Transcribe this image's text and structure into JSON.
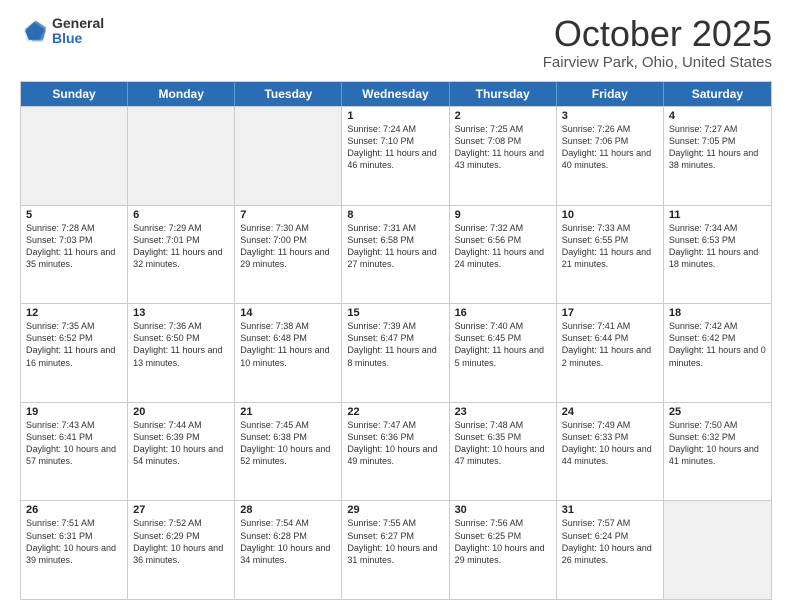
{
  "logo": {
    "general": "General",
    "blue": "Blue"
  },
  "header": {
    "month": "October 2025",
    "location": "Fairview Park, Ohio, United States"
  },
  "days": [
    "Sunday",
    "Monday",
    "Tuesday",
    "Wednesday",
    "Thursday",
    "Friday",
    "Saturday"
  ],
  "rows": [
    [
      {
        "day": "",
        "text": "",
        "shaded": true
      },
      {
        "day": "",
        "text": "",
        "shaded": true
      },
      {
        "day": "",
        "text": "",
        "shaded": true
      },
      {
        "day": "1",
        "text": "Sunrise: 7:24 AM\nSunset: 7:10 PM\nDaylight: 11 hours and 46 minutes."
      },
      {
        "day": "2",
        "text": "Sunrise: 7:25 AM\nSunset: 7:08 PM\nDaylight: 11 hours and 43 minutes."
      },
      {
        "day": "3",
        "text": "Sunrise: 7:26 AM\nSunset: 7:06 PM\nDaylight: 11 hours and 40 minutes."
      },
      {
        "day": "4",
        "text": "Sunrise: 7:27 AM\nSunset: 7:05 PM\nDaylight: 11 hours and 38 minutes."
      }
    ],
    [
      {
        "day": "5",
        "text": "Sunrise: 7:28 AM\nSunset: 7:03 PM\nDaylight: 11 hours and 35 minutes."
      },
      {
        "day": "6",
        "text": "Sunrise: 7:29 AM\nSunset: 7:01 PM\nDaylight: 11 hours and 32 minutes."
      },
      {
        "day": "7",
        "text": "Sunrise: 7:30 AM\nSunset: 7:00 PM\nDaylight: 11 hours and 29 minutes."
      },
      {
        "day": "8",
        "text": "Sunrise: 7:31 AM\nSunset: 6:58 PM\nDaylight: 11 hours and 27 minutes."
      },
      {
        "day": "9",
        "text": "Sunrise: 7:32 AM\nSunset: 6:56 PM\nDaylight: 11 hours and 24 minutes."
      },
      {
        "day": "10",
        "text": "Sunrise: 7:33 AM\nSunset: 6:55 PM\nDaylight: 11 hours and 21 minutes."
      },
      {
        "day": "11",
        "text": "Sunrise: 7:34 AM\nSunset: 6:53 PM\nDaylight: 11 hours and 18 minutes."
      }
    ],
    [
      {
        "day": "12",
        "text": "Sunrise: 7:35 AM\nSunset: 6:52 PM\nDaylight: 11 hours and 16 minutes."
      },
      {
        "day": "13",
        "text": "Sunrise: 7:36 AM\nSunset: 6:50 PM\nDaylight: 11 hours and 13 minutes."
      },
      {
        "day": "14",
        "text": "Sunrise: 7:38 AM\nSunset: 6:48 PM\nDaylight: 11 hours and 10 minutes."
      },
      {
        "day": "15",
        "text": "Sunrise: 7:39 AM\nSunset: 6:47 PM\nDaylight: 11 hours and 8 minutes."
      },
      {
        "day": "16",
        "text": "Sunrise: 7:40 AM\nSunset: 6:45 PM\nDaylight: 11 hours and 5 minutes."
      },
      {
        "day": "17",
        "text": "Sunrise: 7:41 AM\nSunset: 6:44 PM\nDaylight: 11 hours and 2 minutes."
      },
      {
        "day": "18",
        "text": "Sunrise: 7:42 AM\nSunset: 6:42 PM\nDaylight: 11 hours and 0 minutes."
      }
    ],
    [
      {
        "day": "19",
        "text": "Sunrise: 7:43 AM\nSunset: 6:41 PM\nDaylight: 10 hours and 57 minutes."
      },
      {
        "day": "20",
        "text": "Sunrise: 7:44 AM\nSunset: 6:39 PM\nDaylight: 10 hours and 54 minutes."
      },
      {
        "day": "21",
        "text": "Sunrise: 7:45 AM\nSunset: 6:38 PM\nDaylight: 10 hours and 52 minutes."
      },
      {
        "day": "22",
        "text": "Sunrise: 7:47 AM\nSunset: 6:36 PM\nDaylight: 10 hours and 49 minutes."
      },
      {
        "day": "23",
        "text": "Sunrise: 7:48 AM\nSunset: 6:35 PM\nDaylight: 10 hours and 47 minutes."
      },
      {
        "day": "24",
        "text": "Sunrise: 7:49 AM\nSunset: 6:33 PM\nDaylight: 10 hours and 44 minutes."
      },
      {
        "day": "25",
        "text": "Sunrise: 7:50 AM\nSunset: 6:32 PM\nDaylight: 10 hours and 41 minutes."
      }
    ],
    [
      {
        "day": "26",
        "text": "Sunrise: 7:51 AM\nSunset: 6:31 PM\nDaylight: 10 hours and 39 minutes."
      },
      {
        "day": "27",
        "text": "Sunrise: 7:52 AM\nSunset: 6:29 PM\nDaylight: 10 hours and 36 minutes."
      },
      {
        "day": "28",
        "text": "Sunrise: 7:54 AM\nSunset: 6:28 PM\nDaylight: 10 hours and 34 minutes."
      },
      {
        "day": "29",
        "text": "Sunrise: 7:55 AM\nSunset: 6:27 PM\nDaylight: 10 hours and 31 minutes."
      },
      {
        "day": "30",
        "text": "Sunrise: 7:56 AM\nSunset: 6:25 PM\nDaylight: 10 hours and 29 minutes."
      },
      {
        "day": "31",
        "text": "Sunrise: 7:57 AM\nSunset: 6:24 PM\nDaylight: 10 hours and 26 minutes."
      },
      {
        "day": "",
        "text": "",
        "shaded": true
      }
    ]
  ]
}
